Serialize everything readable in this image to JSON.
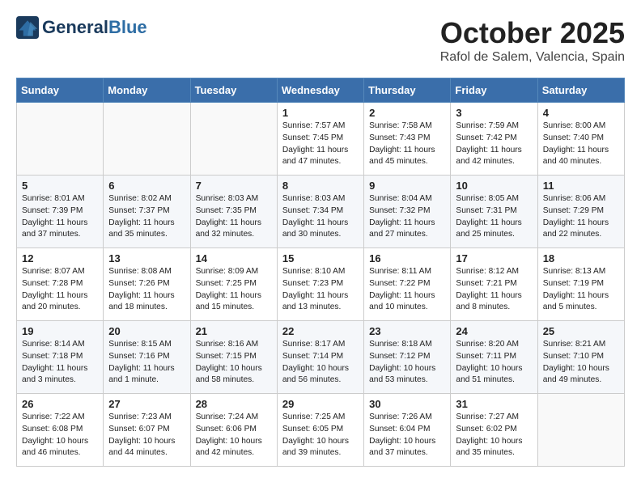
{
  "header": {
    "logo_line1": "General",
    "logo_line2": "Blue",
    "month": "October 2025",
    "location": "Rafol de Salem, Valencia, Spain"
  },
  "weekdays": [
    "Sunday",
    "Monday",
    "Tuesday",
    "Wednesday",
    "Thursday",
    "Friday",
    "Saturday"
  ],
  "weeks": [
    [
      {
        "day": "",
        "content": ""
      },
      {
        "day": "",
        "content": ""
      },
      {
        "day": "",
        "content": ""
      },
      {
        "day": "1",
        "content": "Sunrise: 7:57 AM\nSunset: 7:45 PM\nDaylight: 11 hours\nand 47 minutes."
      },
      {
        "day": "2",
        "content": "Sunrise: 7:58 AM\nSunset: 7:43 PM\nDaylight: 11 hours\nand 45 minutes."
      },
      {
        "day": "3",
        "content": "Sunrise: 7:59 AM\nSunset: 7:42 PM\nDaylight: 11 hours\nand 42 minutes."
      },
      {
        "day": "4",
        "content": "Sunrise: 8:00 AM\nSunset: 7:40 PM\nDaylight: 11 hours\nand 40 minutes."
      }
    ],
    [
      {
        "day": "5",
        "content": "Sunrise: 8:01 AM\nSunset: 7:39 PM\nDaylight: 11 hours\nand 37 minutes."
      },
      {
        "day": "6",
        "content": "Sunrise: 8:02 AM\nSunset: 7:37 PM\nDaylight: 11 hours\nand 35 minutes."
      },
      {
        "day": "7",
        "content": "Sunrise: 8:03 AM\nSunset: 7:35 PM\nDaylight: 11 hours\nand 32 minutes."
      },
      {
        "day": "8",
        "content": "Sunrise: 8:03 AM\nSunset: 7:34 PM\nDaylight: 11 hours\nand 30 minutes."
      },
      {
        "day": "9",
        "content": "Sunrise: 8:04 AM\nSunset: 7:32 PM\nDaylight: 11 hours\nand 27 minutes."
      },
      {
        "day": "10",
        "content": "Sunrise: 8:05 AM\nSunset: 7:31 PM\nDaylight: 11 hours\nand 25 minutes."
      },
      {
        "day": "11",
        "content": "Sunrise: 8:06 AM\nSunset: 7:29 PM\nDaylight: 11 hours\nand 22 minutes."
      }
    ],
    [
      {
        "day": "12",
        "content": "Sunrise: 8:07 AM\nSunset: 7:28 PM\nDaylight: 11 hours\nand 20 minutes."
      },
      {
        "day": "13",
        "content": "Sunrise: 8:08 AM\nSunset: 7:26 PM\nDaylight: 11 hours\nand 18 minutes."
      },
      {
        "day": "14",
        "content": "Sunrise: 8:09 AM\nSunset: 7:25 PM\nDaylight: 11 hours\nand 15 minutes."
      },
      {
        "day": "15",
        "content": "Sunrise: 8:10 AM\nSunset: 7:23 PM\nDaylight: 11 hours\nand 13 minutes."
      },
      {
        "day": "16",
        "content": "Sunrise: 8:11 AM\nSunset: 7:22 PM\nDaylight: 11 hours\nand 10 minutes."
      },
      {
        "day": "17",
        "content": "Sunrise: 8:12 AM\nSunset: 7:21 PM\nDaylight: 11 hours\nand 8 minutes."
      },
      {
        "day": "18",
        "content": "Sunrise: 8:13 AM\nSunset: 7:19 PM\nDaylight: 11 hours\nand 5 minutes."
      }
    ],
    [
      {
        "day": "19",
        "content": "Sunrise: 8:14 AM\nSunset: 7:18 PM\nDaylight: 11 hours\nand 3 minutes."
      },
      {
        "day": "20",
        "content": "Sunrise: 8:15 AM\nSunset: 7:16 PM\nDaylight: 11 hours\nand 1 minute."
      },
      {
        "day": "21",
        "content": "Sunrise: 8:16 AM\nSunset: 7:15 PM\nDaylight: 10 hours\nand 58 minutes."
      },
      {
        "day": "22",
        "content": "Sunrise: 8:17 AM\nSunset: 7:14 PM\nDaylight: 10 hours\nand 56 minutes."
      },
      {
        "day": "23",
        "content": "Sunrise: 8:18 AM\nSunset: 7:12 PM\nDaylight: 10 hours\nand 53 minutes."
      },
      {
        "day": "24",
        "content": "Sunrise: 8:20 AM\nSunset: 7:11 PM\nDaylight: 10 hours\nand 51 minutes."
      },
      {
        "day": "25",
        "content": "Sunrise: 8:21 AM\nSunset: 7:10 PM\nDaylight: 10 hours\nand 49 minutes."
      }
    ],
    [
      {
        "day": "26",
        "content": "Sunrise: 7:22 AM\nSunset: 6:08 PM\nDaylight: 10 hours\nand 46 minutes."
      },
      {
        "day": "27",
        "content": "Sunrise: 7:23 AM\nSunset: 6:07 PM\nDaylight: 10 hours\nand 44 minutes."
      },
      {
        "day": "28",
        "content": "Sunrise: 7:24 AM\nSunset: 6:06 PM\nDaylight: 10 hours\nand 42 minutes."
      },
      {
        "day": "29",
        "content": "Sunrise: 7:25 AM\nSunset: 6:05 PM\nDaylight: 10 hours\nand 39 minutes."
      },
      {
        "day": "30",
        "content": "Sunrise: 7:26 AM\nSunset: 6:04 PM\nDaylight: 10 hours\nand 37 minutes."
      },
      {
        "day": "31",
        "content": "Sunrise: 7:27 AM\nSunset: 6:02 PM\nDaylight: 10 hours\nand 35 minutes."
      },
      {
        "day": "",
        "content": ""
      }
    ]
  ]
}
